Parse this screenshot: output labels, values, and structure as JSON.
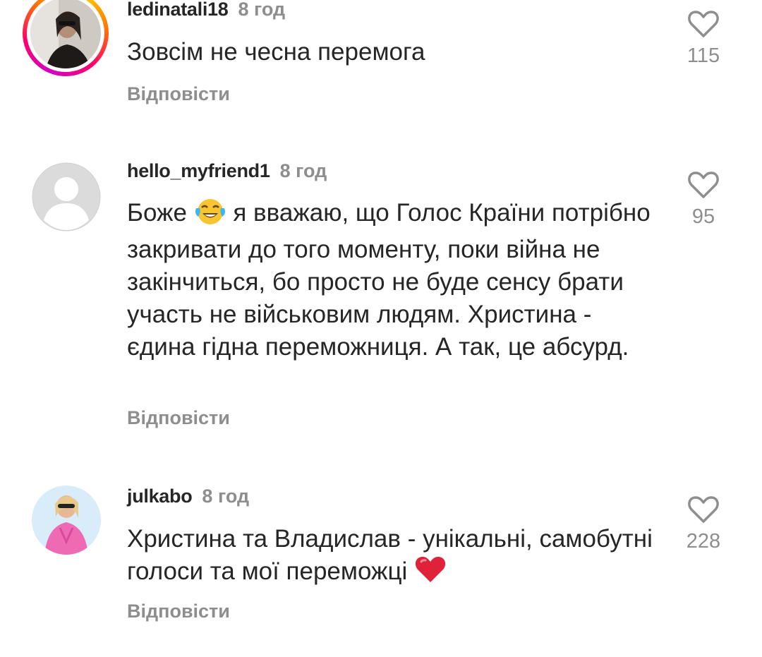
{
  "comments": [
    {
      "username": "ledinatali18",
      "time": "8 год",
      "text": "Зовсім не чесна перемога",
      "reply_label": "Відповісти",
      "likes": "115",
      "avatar": "photo-portrait-dark",
      "avatar_ring": true
    },
    {
      "username": "hello_myfriend1",
      "time": "8 год",
      "text_before_emoji": "Боже ",
      "emoji": "tears-of-joy-emoji",
      "text_after_emoji": " я вважаю, що Голос Країни потрібно закривати до того моменту, поки війна не закінчиться, бо просто не буде сенсу брати участь не військовим людям. Христина - єдина гідна переможниця. А так, це абсурд.",
      "reply_label": "Відповісти",
      "likes": "95",
      "avatar": "default-user-silhouette"
    },
    {
      "username": "julkabo",
      "time": "8 год",
      "text_before_emoji": "Христина та Владислав - унікальні, самобутні голоси та мої переможці ",
      "emoji": "red-heart-emoji",
      "reply_label": "Відповісти",
      "likes": "228",
      "avatar": "photo-woman-pink-dress"
    }
  ],
  "colors": {
    "text": "#262626",
    "secondary": "#8e8e8e",
    "heart_emoji": "#e0213a"
  }
}
